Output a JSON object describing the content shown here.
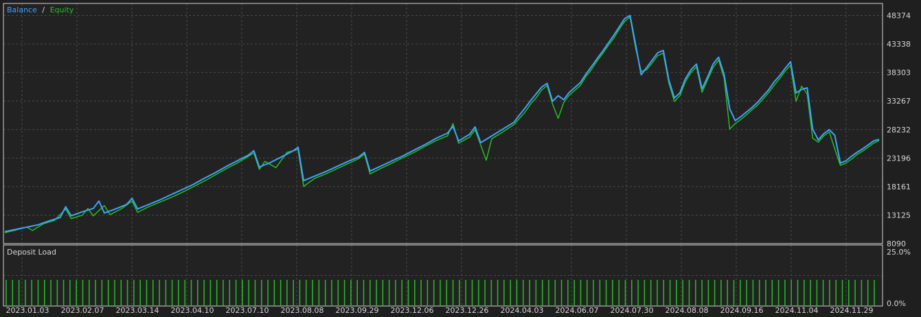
{
  "colors": {
    "background": "#222222",
    "frame": "#d6d6d6",
    "grid": "#4a4a4a",
    "balance": "#3fa3ff",
    "equity": "#23c21f",
    "deposit_bar": "#23c21f",
    "text": "#d6d6d6"
  },
  "legend": {
    "balance": "Balance",
    "separator": "/",
    "equity": "Equity"
  },
  "deposit_panel": {
    "title": "Deposit Load",
    "axis_top": "25.0%",
    "axis_bottom": "0.0%"
  },
  "chart_data": {
    "type": "line",
    "y_ticks": [
      48374,
      43338,
      38303,
      33267,
      28232,
      23196,
      18161,
      13125,
      8090
    ],
    "ylim": [
      8090,
      50500
    ],
    "x_ticks": [
      "2023.01.03",
      "2023.02.07",
      "2023.03.14",
      "2023.04.10",
      "2023.07.10",
      "2023.08.08",
      "2023.09.29",
      "2023.12.06",
      "2023.12.26",
      "2024.04.03",
      "2024.06.07",
      "2024.07.30",
      "2024.08.08",
      "2024.09.16",
      "2024.11.04",
      "2024.11.29"
    ],
    "series": [
      {
        "name": "Balance",
        "points": [
          [
            0,
            10200
          ],
          [
            3,
            10800
          ],
          [
            6,
            11400
          ],
          [
            8,
            12100
          ],
          [
            10,
            12700
          ],
          [
            11,
            14600
          ],
          [
            12,
            13000
          ],
          [
            14,
            13700
          ],
          [
            16,
            14300
          ],
          [
            17,
            15600
          ],
          [
            18,
            13500
          ],
          [
            20,
            14200
          ],
          [
            22,
            15000
          ],
          [
            23,
            16100
          ],
          [
            24,
            14200
          ],
          [
            26,
            15000
          ],
          [
            28,
            15800
          ],
          [
            30,
            16700
          ],
          [
            32,
            17600
          ],
          [
            34,
            18500
          ],
          [
            36,
            19600
          ],
          [
            38,
            20600
          ],
          [
            40,
            21700
          ],
          [
            42,
            22700
          ],
          [
            44,
            23700
          ],
          [
            45,
            24500
          ],
          [
            46,
            21600
          ],
          [
            48,
            22400
          ],
          [
            50,
            23400
          ],
          [
            52,
            24400
          ],
          [
            53,
            25100
          ],
          [
            54,
            19200
          ],
          [
            56,
            20000
          ],
          [
            58,
            20800
          ],
          [
            60,
            21700
          ],
          [
            62,
            22600
          ],
          [
            64,
            23400
          ],
          [
            65,
            24200
          ],
          [
            66,
            20900
          ],
          [
            68,
            21800
          ],
          [
            70,
            22700
          ],
          [
            72,
            23600
          ],
          [
            74,
            24600
          ],
          [
            76,
            25600
          ],
          [
            78,
            26700
          ],
          [
            80,
            27600
          ],
          [
            81,
            28800
          ],
          [
            82,
            26200
          ],
          [
            84,
            27400
          ],
          [
            85,
            28700
          ],
          [
            86,
            25900
          ],
          [
            88,
            27100
          ],
          [
            90,
            28300
          ],
          [
            92,
            29500
          ],
          [
            93,
            30800
          ],
          [
            94,
            32000
          ],
          [
            95,
            33300
          ],
          [
            96,
            34500
          ],
          [
            97,
            35700
          ],
          [
            98,
            36400
          ],
          [
            99,
            33200
          ],
          [
            100,
            34200
          ],
          [
            101,
            33500
          ],
          [
            102,
            34800
          ],
          [
            104,
            36500
          ],
          [
            105,
            38000
          ],
          [
            106,
            39300
          ],
          [
            107,
            40700
          ],
          [
            108,
            42000
          ],
          [
            109,
            43400
          ],
          [
            110,
            44800
          ],
          [
            111,
            46300
          ],
          [
            112,
            47800
          ],
          [
            113,
            48374
          ],
          [
            114,
            43200
          ],
          [
            115,
            37900
          ],
          [
            116,
            39200
          ],
          [
            117,
            40500
          ],
          [
            118,
            41800
          ],
          [
            119,
            42200
          ],
          [
            120,
            37000
          ],
          [
            121,
            33800
          ],
          [
            122,
            34700
          ],
          [
            123,
            37200
          ],
          [
            124,
            38800
          ],
          [
            125,
            39800
          ],
          [
            126,
            35400
          ],
          [
            127,
            37500
          ],
          [
            128,
            39800
          ],
          [
            129,
            41000
          ],
          [
            130,
            37900
          ],
          [
            131,
            31900
          ],
          [
            132,
            29800
          ],
          [
            133,
            30500
          ],
          [
            134,
            31300
          ],
          [
            135,
            32100
          ],
          [
            136,
            33000
          ],
          [
            137,
            34100
          ],
          [
            138,
            35200
          ],
          [
            139,
            36600
          ],
          [
            140,
            37700
          ],
          [
            141,
            39000
          ],
          [
            142,
            40200
          ],
          [
            143,
            34700
          ],
          [
            144,
            35300
          ],
          [
            145,
            35600
          ],
          [
            146,
            28300
          ],
          [
            147,
            26400
          ],
          [
            148,
            27500
          ],
          [
            149,
            28200
          ],
          [
            150,
            27200
          ],
          [
            151,
            22300
          ],
          [
            152,
            22700
          ],
          [
            153,
            23500
          ],
          [
            154,
            24200
          ],
          [
            155,
            24800
          ],
          [
            156,
            25500
          ],
          [
            157,
            26200
          ],
          [
            158,
            26500
          ]
        ]
      },
      {
        "name": "Equity",
        "points": [
          [
            0,
            10000
          ],
          [
            2,
            10500
          ],
          [
            4,
            11000
          ],
          [
            5,
            10400
          ],
          [
            7,
            11600
          ],
          [
            9,
            12200
          ],
          [
            11,
            14200
          ],
          [
            12,
            12500
          ],
          [
            14,
            13100
          ],
          [
            15,
            14300
          ],
          [
            16,
            13000
          ],
          [
            18,
            14800
          ],
          [
            19,
            13200
          ],
          [
            21,
            14200
          ],
          [
            23,
            15600
          ],
          [
            24,
            13600
          ],
          [
            26,
            14600
          ],
          [
            28,
            15400
          ],
          [
            30,
            16200
          ],
          [
            32,
            17100
          ],
          [
            34,
            18100
          ],
          [
            36,
            19100
          ],
          [
            38,
            20200
          ],
          [
            40,
            21300
          ],
          [
            42,
            22300
          ],
          [
            44,
            23500
          ],
          [
            45,
            24100
          ],
          [
            46,
            21200
          ],
          [
            47,
            22600
          ],
          [
            49,
            21500
          ],
          [
            51,
            24200
          ],
          [
            53,
            24700
          ],
          [
            54,
            18200
          ],
          [
            56,
            19600
          ],
          [
            58,
            20400
          ],
          [
            60,
            21300
          ],
          [
            62,
            22200
          ],
          [
            64,
            23100
          ],
          [
            65,
            23900
          ],
          [
            66,
            20400
          ],
          [
            68,
            21400
          ],
          [
            70,
            22300
          ],
          [
            72,
            23300
          ],
          [
            74,
            24200
          ],
          [
            76,
            25300
          ],
          [
            78,
            26300
          ],
          [
            80,
            27100
          ],
          [
            81,
            29300
          ],
          [
            82,
            25800
          ],
          [
            84,
            26900
          ],
          [
            85,
            28200
          ],
          [
            86,
            25500
          ],
          [
            87,
            22800
          ],
          [
            88,
            26600
          ],
          [
            90,
            27800
          ],
          [
            92,
            29100
          ],
          [
            93,
            30200
          ],
          [
            94,
            31300
          ],
          [
            95,
            32700
          ],
          [
            96,
            33800
          ],
          [
            97,
            35200
          ],
          [
            98,
            36000
          ],
          [
            99,
            32700
          ],
          [
            100,
            30200
          ],
          [
            101,
            33000
          ],
          [
            102,
            34300
          ],
          [
            104,
            36000
          ],
          [
            105,
            37600
          ],
          [
            106,
            38800
          ],
          [
            107,
            40300
          ],
          [
            108,
            41600
          ],
          [
            109,
            43000
          ],
          [
            110,
            44300
          ],
          [
            111,
            45900
          ],
          [
            112,
            47300
          ],
          [
            113,
            48100
          ],
          [
            114,
            42600
          ],
          [
            115,
            38500
          ],
          [
            116,
            38800
          ],
          [
            117,
            40000
          ],
          [
            118,
            41300
          ],
          [
            119,
            41700
          ],
          [
            120,
            36500
          ],
          [
            121,
            33200
          ],
          [
            122,
            34200
          ],
          [
            123,
            36700
          ],
          [
            124,
            38300
          ],
          [
            125,
            39300
          ],
          [
            126,
            34800
          ],
          [
            127,
            37000
          ],
          [
            128,
            39200
          ],
          [
            129,
            40500
          ],
          [
            130,
            37300
          ],
          [
            131,
            28300
          ],
          [
            132,
            29300
          ],
          [
            133,
            30000
          ],
          [
            134,
            30800
          ],
          [
            135,
            31700
          ],
          [
            136,
            32500
          ],
          [
            137,
            33600
          ],
          [
            138,
            34700
          ],
          [
            139,
            36000
          ],
          [
            140,
            37200
          ],
          [
            141,
            38500
          ],
          [
            142,
            39600
          ],
          [
            143,
            33200
          ],
          [
            144,
            35900
          ],
          [
            145,
            34500
          ],
          [
            146,
            26700
          ],
          [
            147,
            26000
          ],
          [
            148,
            27100
          ],
          [
            149,
            27800
          ],
          [
            150,
            24800
          ],
          [
            151,
            21900
          ],
          [
            152,
            22300
          ],
          [
            153,
            23000
          ],
          [
            154,
            23800
          ],
          [
            155,
            24400
          ],
          [
            156,
            25100
          ],
          [
            157,
            25800
          ],
          [
            158,
            26300
          ]
        ]
      }
    ],
    "deposit_load": {
      "name": "Deposit Load",
      "ylim": [
        0,
        25
      ],
      "bar_value_percent": 10.7,
      "bar_count": 137
    }
  }
}
